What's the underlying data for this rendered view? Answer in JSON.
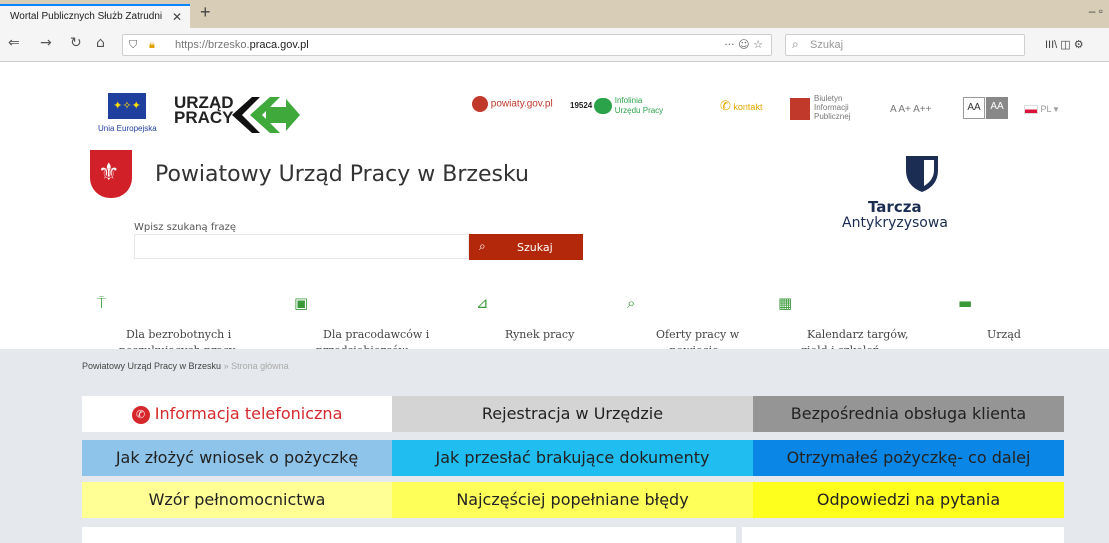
{
  "browser": {
    "tab_title": "Wortal Publicznych Służb Zatrudni",
    "tab_close": "✕",
    "new_tab": "+",
    "window_controls": "–  ▫",
    "url_prefix": "https://brzesko.",
    "url_domain": "praca.gov.pl",
    "url_actions": "···  ☺  ☆",
    "search_placeholder": "Szukaj",
    "toolbar_icons": "III\\  ◫  ⚙"
  },
  "header": {
    "eu_label": "Unia Europejska",
    "up_logo": "URZĄD\nPRACY",
    "powiaty": "powiaty.gov.pl",
    "infolinia_number": "19524",
    "infolinia_label": "Infolinia\nUrzędu Pracy",
    "kontakt": "kontakt",
    "bip": "Biuletyn\nInformacji\nPublicznej",
    "font_sizes": "A  A+  A++",
    "contrast_1": "AA",
    "contrast_2": "AA",
    "lang": "PL ▾",
    "site_title": "Powiatowy Urząd Pracy w Brzesku",
    "search_label": "Wpisz szukaną frazę",
    "search_button": "Szukaj",
    "tarcza_1": "Tarcza",
    "tarcza_2": "Antykryzysowa"
  },
  "menu": [
    {
      "label": "Dla bezrobotnych i\nposzukujących pracy",
      "icon": "signpost-icon"
    },
    {
      "label": "Dla pracodawców i\nprzedsiębiorców",
      "icon": "briefcase-icon"
    },
    {
      "label": "Rynek pracy",
      "icon": "chart-icon"
    },
    {
      "label": "Oferty pracy w\npowiecie",
      "icon": "search-icon"
    },
    {
      "label": "Kalendarz targów,\ngield i szkoleń",
      "icon": "calendar-icon"
    },
    {
      "label": "Urząd",
      "icon": "building-icon"
    }
  ],
  "breadcrumb": {
    "home": "Powiatowy Urząd Pracy w Brzesku",
    "separator": "»",
    "current": "Strona główna"
  },
  "tiles": [
    {
      "label": "Informacja telefoniczna",
      "bg": "#ffffff",
      "color": "#d6282c"
    },
    {
      "label": "Rejestracja w Urzędzie",
      "bg": "#d4d4d4",
      "color": "#222222"
    },
    {
      "label": "Bezpośrednia obsługa klienta",
      "bg": "#959595",
      "color": "#222222"
    },
    {
      "label": "Jak złożyć wniosek o pożyczkę",
      "bg": "#8fc4ea",
      "color": "#222222"
    },
    {
      "label": "Jak przesłać brakujące dokumenty",
      "bg": "#1fbdf0",
      "color": "#222222"
    },
    {
      "label": "Otrzymałeś pożyczkę- co dalej",
      "bg": "#0a86e6",
      "color": "#222222"
    },
    {
      "label": "Wzór pełnomocnictwa",
      "bg": "#ffff96",
      "color": "#222222"
    },
    {
      "label": "Najczęściej popełniane błędy",
      "bg": "#ffff5a",
      "color": "#222222"
    },
    {
      "label": "Odpowiedzi na pytania",
      "bg": "#ffff1e",
      "color": "#222222"
    }
  ]
}
